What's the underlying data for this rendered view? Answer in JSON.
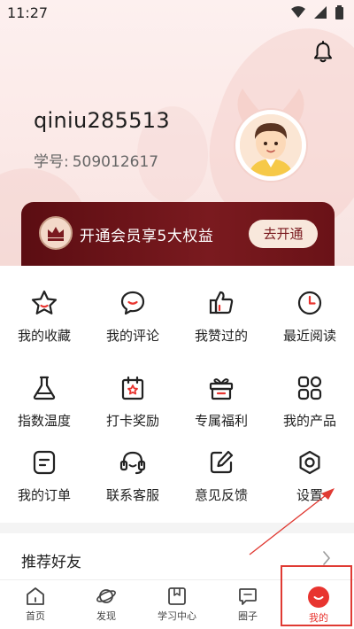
{
  "status_bar": {
    "time": "11:27"
  },
  "profile": {
    "username": "qiniu285513",
    "student_id_label": "学号:",
    "student_id": "509012617"
  },
  "vip_banner": {
    "text": "开通会员享5大权益",
    "button_label": "去开通"
  },
  "menu": [
    {
      "label": "我的收藏",
      "icon": "star-icon"
    },
    {
      "label": "我的评论",
      "icon": "comment-icon"
    },
    {
      "label": "我赞过的",
      "icon": "thumbs-up-icon"
    },
    {
      "label": "最近阅读",
      "icon": "clock-icon"
    },
    {
      "label": "指数温度",
      "icon": "flask-icon"
    },
    {
      "label": "打卡奖励",
      "icon": "calendar-star-icon"
    },
    {
      "label": "专属福利",
      "icon": "gift-icon"
    },
    {
      "label": "我的产品",
      "icon": "grid-icon"
    },
    {
      "label": "我的订单",
      "icon": "order-icon"
    },
    {
      "label": "联系客服",
      "icon": "headset-icon"
    },
    {
      "label": "意见反馈",
      "icon": "edit-icon"
    },
    {
      "label": "设置",
      "icon": "settings-icon"
    }
  ],
  "recommend": {
    "label": "推荐好友"
  },
  "tabs": [
    {
      "label": "首页",
      "icon": "home-icon"
    },
    {
      "label": "发现",
      "icon": "planet-icon"
    },
    {
      "label": "学习中心",
      "icon": "book-icon"
    },
    {
      "label": "圈子",
      "icon": "chat-icon"
    },
    {
      "label": "我的",
      "icon": "profile-icon",
      "active": true
    }
  ],
  "colors": {
    "accent": "#e8342f",
    "vip_bg": "#6a1217",
    "annotation": "#e03a33"
  }
}
